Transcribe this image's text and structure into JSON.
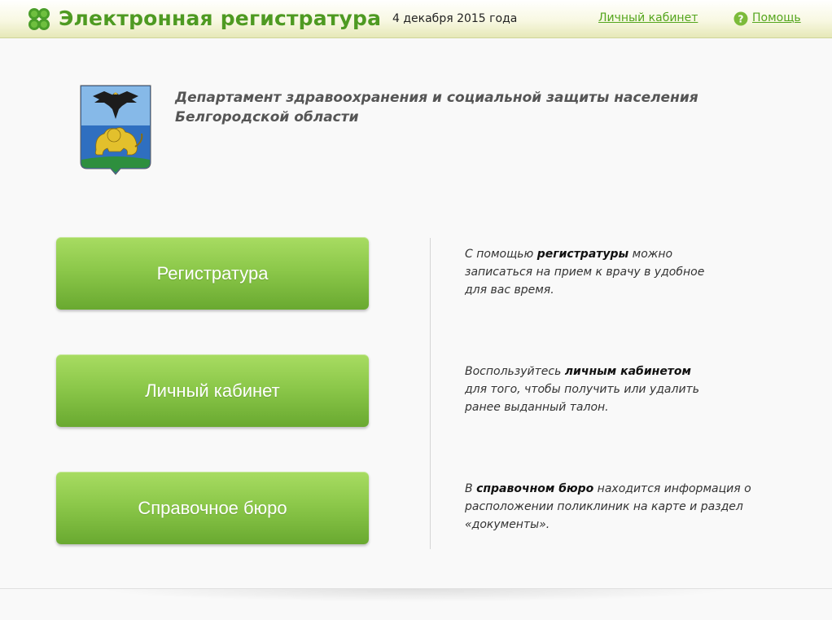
{
  "header": {
    "app_title": "Электронная регистратура",
    "date": "4 декабря 2015 года",
    "cabinet_link": "Личный кабинет",
    "help_link": "Помощь",
    "brand_color": "#4e9a22",
    "link_color": "#55a61e",
    "logo_icon": "clover-icon",
    "help_icon": "question-icon"
  },
  "organization": {
    "line1": "Департамент здравоохранения и социальной защиты населения",
    "line2": "Белгородской области",
    "emblem_icon": "belgorod-coat-of-arms"
  },
  "menu": [
    {
      "label": "Регистратура",
      "desc_pre": "С помощью ",
      "desc_bold": "регистратуры",
      "desc_line1_post": " можно",
      "desc_line2": "записаться на прием к врачу в удобное",
      "desc_line3": "для вас время."
    },
    {
      "label": "Личный кабинет",
      "desc_pre": "Воспользуйтесь ",
      "desc_bold": "личным кабинетом",
      "desc_line1_post": "",
      "desc_line2": "для того, чтобы получить или удалить",
      "desc_line3": "ранее выданный талон."
    },
    {
      "label": "Справочное бюро",
      "desc_pre": "В ",
      "desc_bold": "справочном бюро",
      "desc_line1_post": " находится информация о",
      "desc_line2": "расположении поликлиник на карте и раздел",
      "desc_line3": "«документы»."
    }
  ],
  "colors": {
    "button_top": "#a8dc62",
    "button_bottom": "#69a930",
    "header_bg": "#f8f8e2"
  }
}
